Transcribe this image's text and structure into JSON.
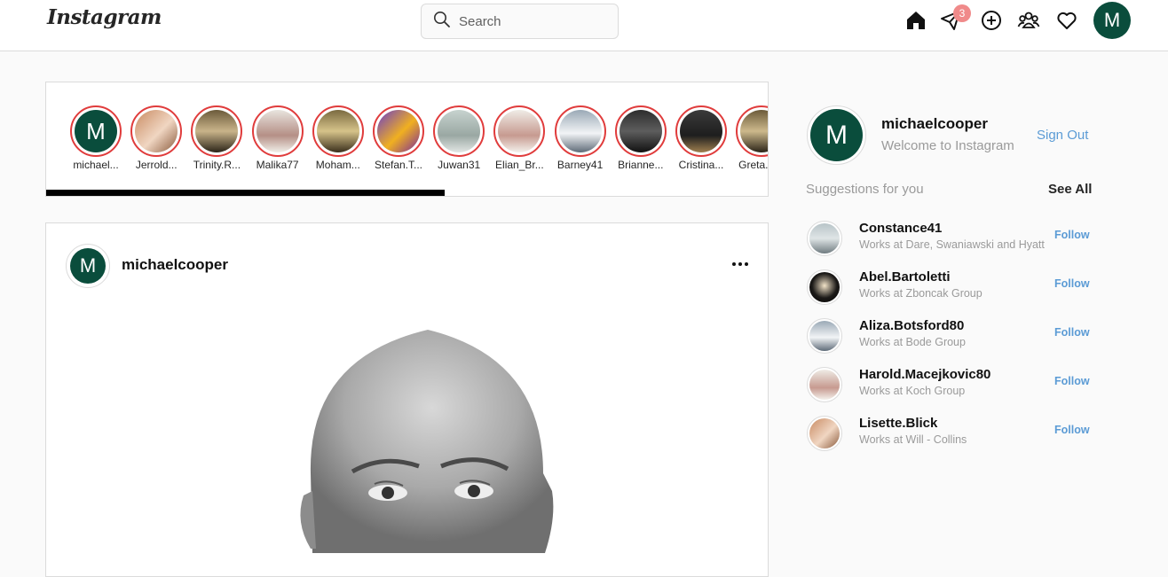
{
  "header": {
    "logo": "Instagram",
    "search_placeholder": "Search",
    "icons": [
      "home-icon",
      "send-icon",
      "add-icon",
      "people-icon",
      "heart-icon"
    ],
    "notification_count": "3",
    "avatar_letter": "M"
  },
  "stories": [
    {
      "name": "michael...",
      "avatar": "M"
    },
    {
      "name": "Jerrold...",
      "avatar": "photo"
    },
    {
      "name": "Trinity.R...",
      "avatar": "photo"
    },
    {
      "name": "Malika77",
      "avatar": "photo"
    },
    {
      "name": "Moham...",
      "avatar": "photo"
    },
    {
      "name": "Stefan.T...",
      "avatar": "photo"
    },
    {
      "name": "Juwan31",
      "avatar": "photo"
    },
    {
      "name": "Elian_Br...",
      "avatar": "photo"
    },
    {
      "name": "Barney41",
      "avatar": "photo"
    },
    {
      "name": "Brianne...",
      "avatar": "photo"
    },
    {
      "name": "Cristina...",
      "avatar": "photo"
    },
    {
      "name": "Greta.C...",
      "avatar": "photo"
    }
  ],
  "post": {
    "avatar_letter": "M",
    "username": "michaelcooper"
  },
  "sidebar": {
    "avatar_letter": "M",
    "username": "michaelcooper",
    "welcome": "Welcome to Instagram",
    "sign_out": "Sign Out",
    "suggestions_title": "Suggestions for you",
    "see_all": "See All",
    "suggestions": [
      {
        "name": "Constance41",
        "subtitle": "Works at Dare, Swaniawski and Hyatt",
        "action": "Follow"
      },
      {
        "name": "Abel.Bartoletti",
        "subtitle": "Works at Zboncak Group",
        "action": "Follow"
      },
      {
        "name": "Aliza.Botsford80",
        "subtitle": "Works at Bode Group",
        "action": "Follow"
      },
      {
        "name": "Harold.Macejkovic80",
        "subtitle": "Works at Koch Group",
        "action": "Follow"
      },
      {
        "name": "Lisette.Blick",
        "subtitle": "Works at Will - Collins",
        "action": "Follow"
      }
    ]
  },
  "colors": {
    "brand_avatar": "#0a4d3c",
    "story_ring": "#e03c3c",
    "link_blue": "#5b9bd5",
    "badge": "#f08a8a"
  }
}
